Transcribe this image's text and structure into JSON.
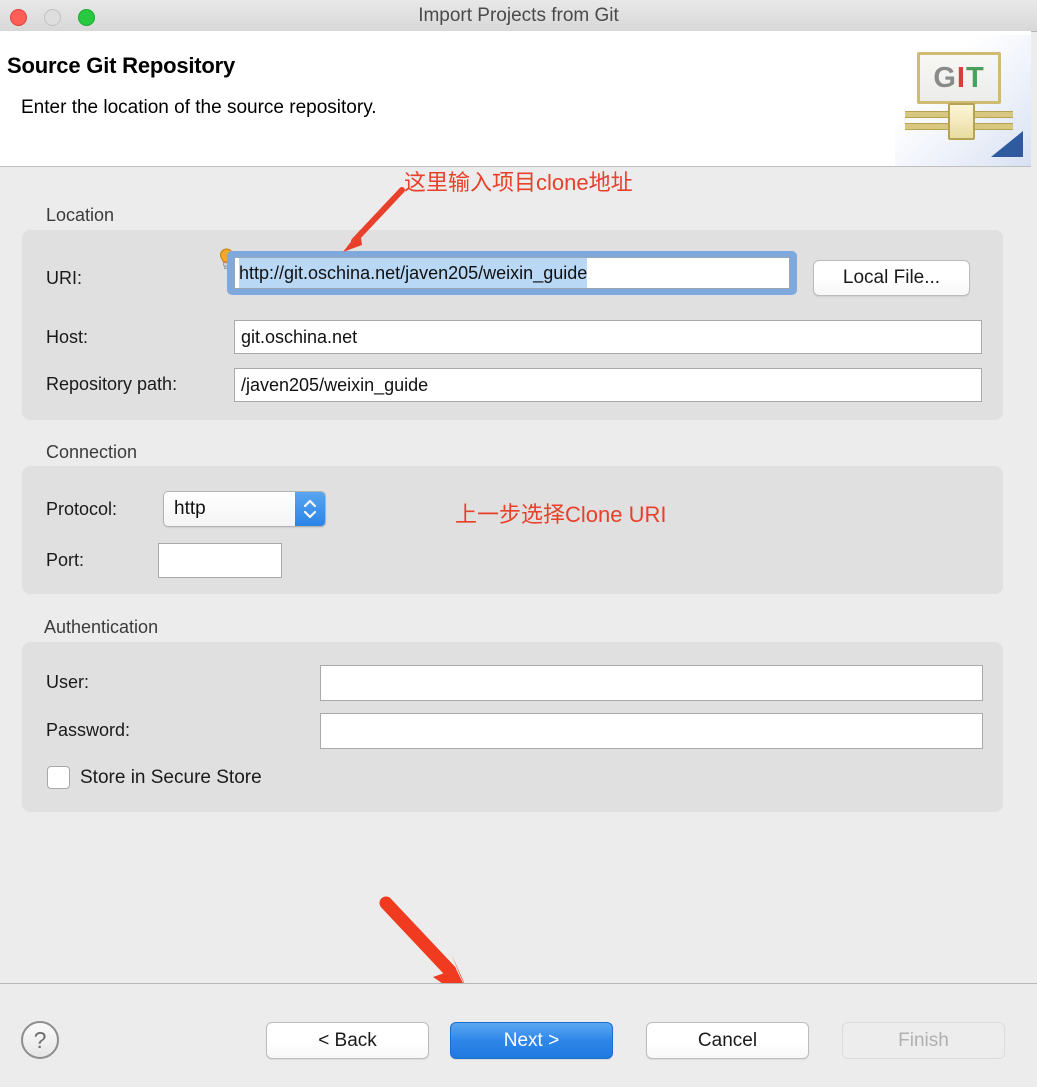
{
  "window": {
    "title": "Import Projects from Git",
    "traffic_lights": [
      {
        "name": "close",
        "color": "#ff5f57"
      },
      {
        "name": "minimize",
        "color": "#dedede"
      },
      {
        "name": "zoom",
        "color": "#28c840"
      }
    ]
  },
  "header": {
    "title": "Source Git Repository",
    "subtitle": "Enter the location of the source repository.",
    "logo": {
      "letters": [
        "G",
        "I",
        "T"
      ],
      "letter_colors": [
        "#8a8a8a",
        "#d43f3a",
        "#4aa05a"
      ]
    }
  },
  "location": {
    "group_label": "Location",
    "uri": {
      "label": "URI:",
      "value": "http://git.oschina.net/javen205/weixin_guide",
      "selected": true,
      "focused": true
    },
    "host": {
      "label": "Host:",
      "value": "git.oschina.net"
    },
    "repository_path": {
      "label": "Repository path:",
      "value": "/javen205/weixin_guide"
    },
    "local_file_button": "Local File..."
  },
  "connection": {
    "group_label": "Connection",
    "protocol": {
      "label": "Protocol:",
      "value": "http"
    },
    "port": {
      "label": "Port:",
      "value": "",
      "placeholder": ""
    }
  },
  "authentication": {
    "group_label": "Authentication",
    "user": {
      "label": "User:",
      "value": "",
      "placeholder": ""
    },
    "password": {
      "label": "Password:",
      "value": "",
      "placeholder": ""
    },
    "store_secure": {
      "label": "Store in Secure Store",
      "checked": false
    }
  },
  "annotations": {
    "uri_hint": "这里输入项目clone地址",
    "protocol_hint": "上一步选择Clone URI",
    "color": "#e8402a"
  },
  "footer": {
    "help_label": "?",
    "back_button": "< Back",
    "next_button": "Next >",
    "cancel_button": "Cancel",
    "finish_button": "Finish",
    "finish_disabled": true,
    "default_button_color": "#2e86e8"
  }
}
